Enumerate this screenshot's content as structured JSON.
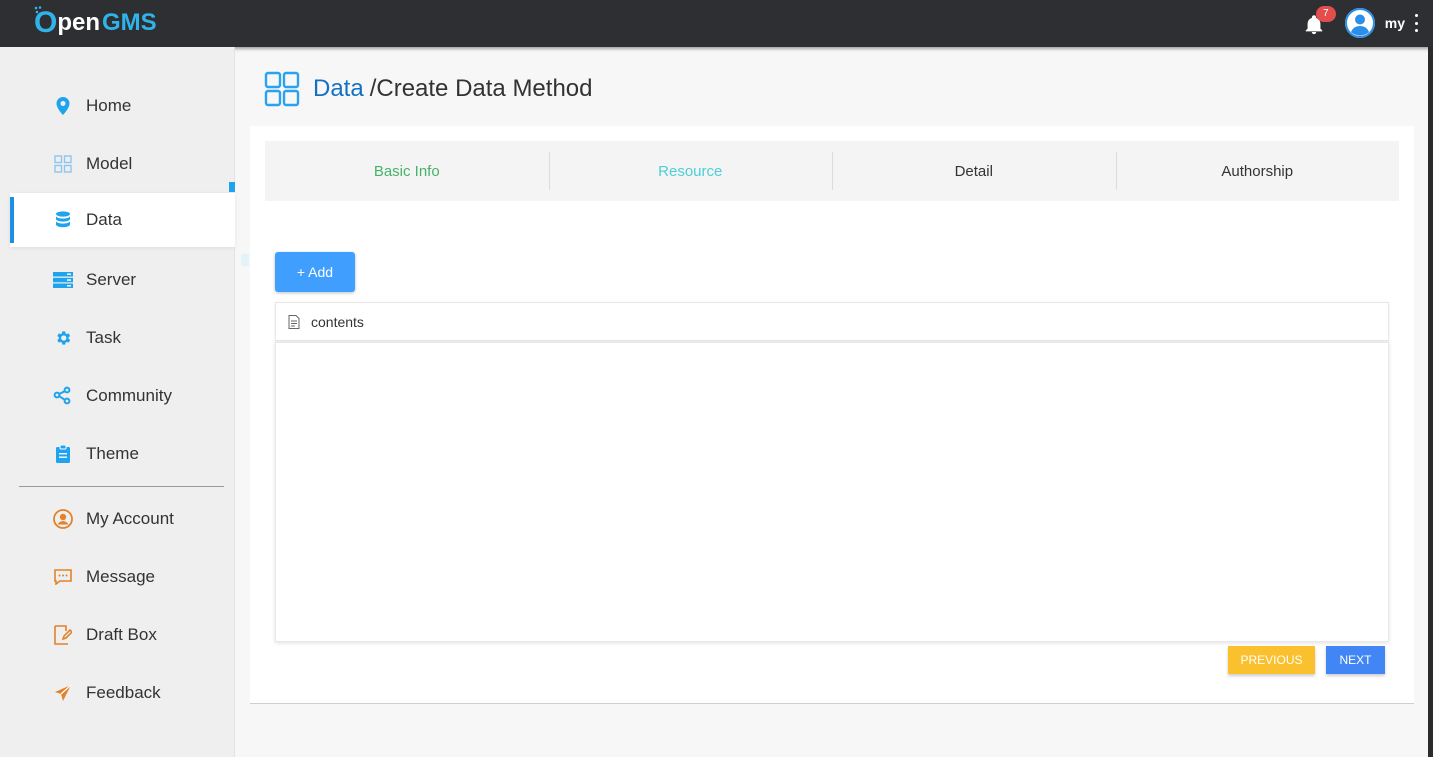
{
  "header": {
    "logo_o": "O",
    "logo_pen": "pen",
    "logo_gms": "GMS",
    "notification_count": "7",
    "username": "my"
  },
  "sidebar": {
    "items": [
      {
        "label": "Home",
        "icon": "location-pin-icon"
      },
      {
        "label": "Model",
        "icon": "grid-icon"
      },
      {
        "label": "Data",
        "icon": "database-icon"
      },
      {
        "label": "Server",
        "icon": "server-icon"
      },
      {
        "label": "Task",
        "icon": "gear-icon"
      },
      {
        "label": "Community",
        "icon": "share-icon"
      },
      {
        "label": "Theme",
        "icon": "clipboard-icon"
      }
    ],
    "account_items": [
      {
        "label": "My Account",
        "icon": "user-circle-icon"
      },
      {
        "label": "Message",
        "icon": "chat-icon"
      },
      {
        "label": "Draft Box",
        "icon": "edit-document-icon"
      },
      {
        "label": "Feedback",
        "icon": "paper-plane-icon"
      }
    ],
    "active": "Data"
  },
  "page": {
    "breadcrumb_section": "Data",
    "breadcrumb_page": "/Create Data Method"
  },
  "steps": [
    "Basic Info",
    "Resource",
    "Detail",
    "Authorship"
  ],
  "resource": {
    "add_label": "+ Add",
    "tree_root_label": "contents"
  },
  "footer_buttons": {
    "previous_label": "PREVIOUS",
    "next_label": "NEXT"
  },
  "colors": {
    "accent_blue": "#409eff",
    "step_done": "#45b36b",
    "step_current": "#4ccfd6",
    "previous_button": "#fbc02d",
    "next_button": "#4285f4",
    "topbar": "#2d2f33"
  }
}
